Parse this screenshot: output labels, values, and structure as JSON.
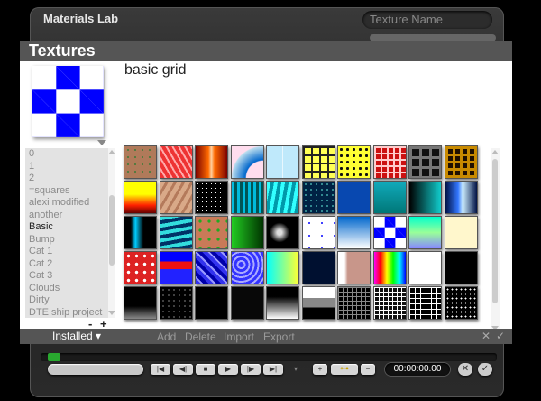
{
  "window": {
    "title": "Materials Lab",
    "texture_name_label": "Texture Name"
  },
  "panel": {
    "title": "Textures",
    "selected_texture_name": "basic grid"
  },
  "categories": [
    "0",
    "1",
    "2",
    "=squares",
    "alexi modified",
    "another",
    "Basic",
    "Bump",
    "Cat 1",
    "Cat 2",
    "Cat 3",
    "Clouds",
    "Dirty",
    "DTE ship project"
  ],
  "selected_category": "Basic",
  "list_controls": {
    "minus": "-",
    "plus": "+"
  },
  "bottom_bar": {
    "installed": "Installed",
    "actions": [
      "Add",
      "Delete",
      "Import",
      "Export"
    ]
  },
  "playback": {
    "time": "00:00:00.00"
  },
  "textures": [
    "brown-dotted",
    "red-triangles",
    "red-orange-stripes",
    "blue-arc",
    "light-blue-tiles",
    "yellow-squares",
    "yellow-black-pattern",
    "red-squares",
    "black-gray-tiles",
    "brown-maze",
    "yellow-red-flames",
    "tan-wood",
    "black-white-noise",
    "cyan-stripes",
    "cyan-waves",
    "dark-teal-noise",
    "blue-solid",
    "teal-gradient",
    "teal-dark-gradient",
    "blue-gradient",
    "black-cyan-gradient",
    "cyan-streaks",
    "green-dots",
    "green-black-gradient",
    "black-white-splash",
    "white-blue-dots",
    "blue-white-gradient",
    "basic-grid",
    "green-cyan-gradient",
    "cream",
    "red-white-splatter",
    "blue-red-bands",
    "blue-marble",
    "blue-swirl",
    "cyan-yellow-gradient",
    "dark-navy",
    "brown-white-rock",
    "rainbow",
    "white",
    "black",
    "black-gray-bottom",
    "black-white-speckle",
    "black-solid",
    "black-dark",
    "gray-white-gradient",
    "gray-stripes",
    "black-grid",
    "gray-white-grid",
    "white-black-grid",
    "black-white-dots"
  ]
}
